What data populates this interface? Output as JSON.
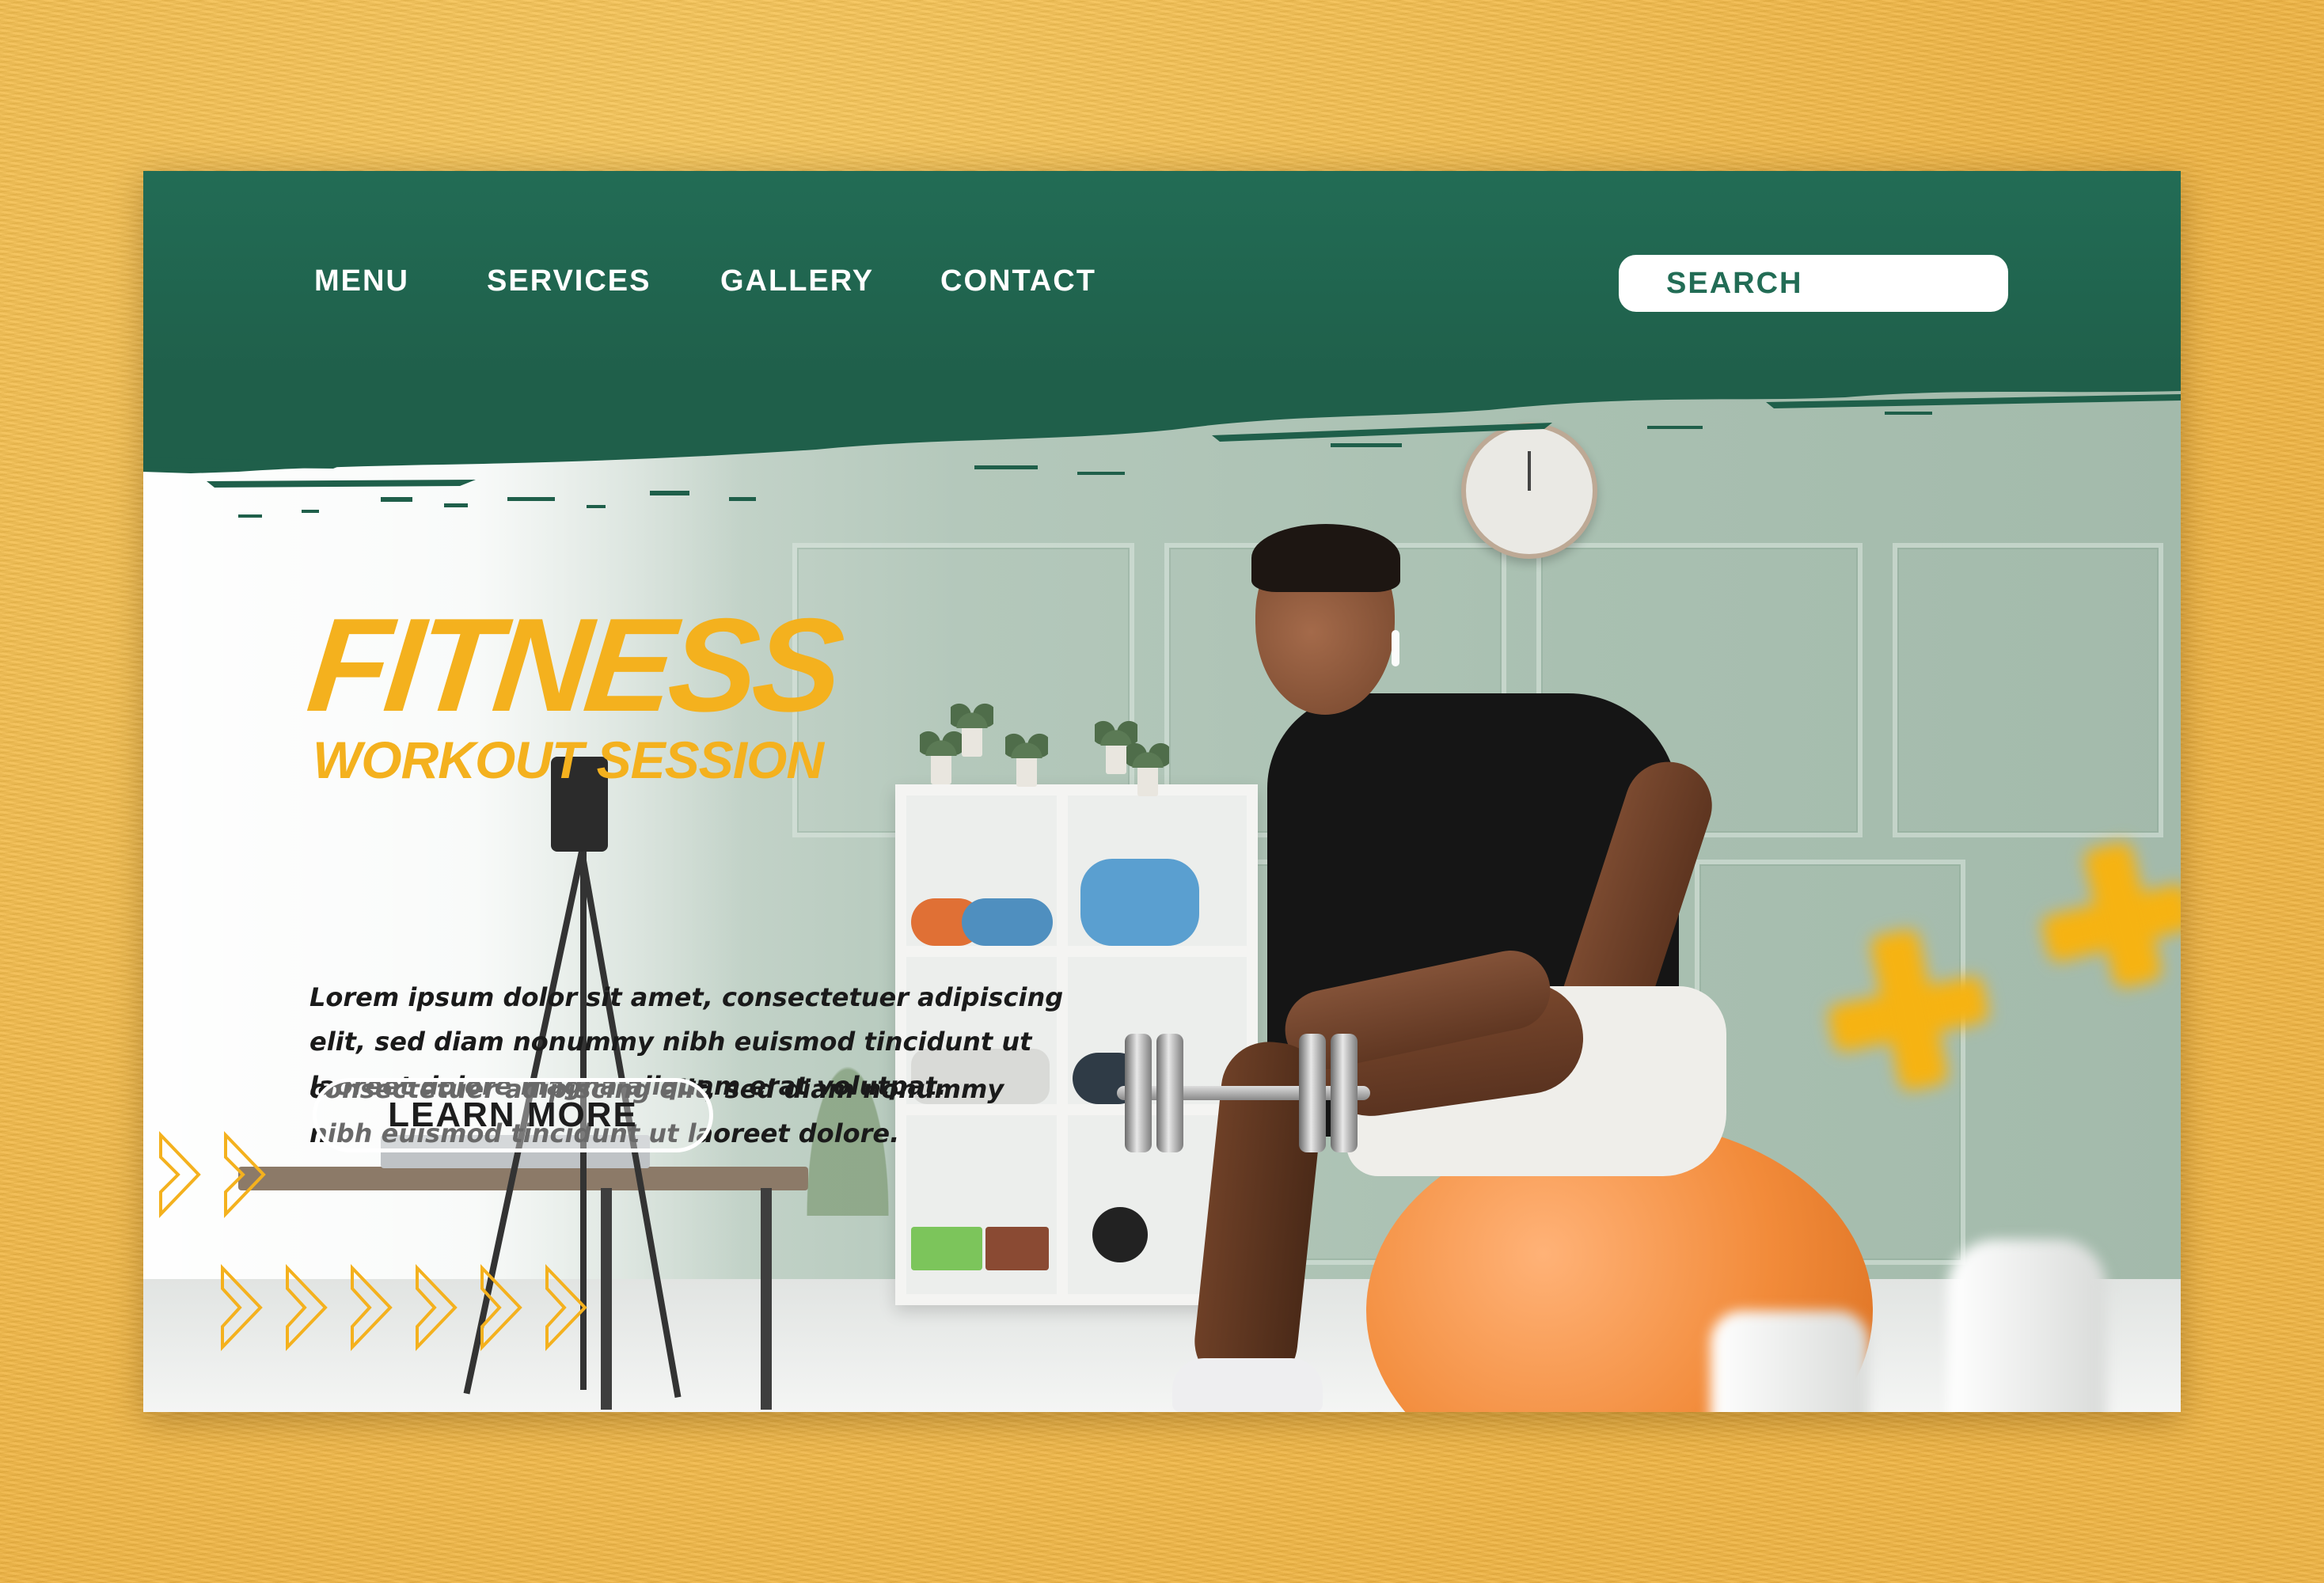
{
  "nav": {
    "items": [
      {
        "label": "MENU"
      },
      {
        "label": "SERVICES"
      },
      {
        "label": "GALLERY"
      },
      {
        "label": "CONTACT"
      }
    ],
    "search_label": "SEARCH"
  },
  "hero": {
    "title": "FITNESS",
    "subtitle": "WORKOUT SESSION",
    "paragraph_1": "Lorem ipsum dolor sit amet, consectetuer adipiscing elit, sed diam nonummy nibh euismod tincidunt ut laoreet dolore magna aliquam erat volutpat.",
    "paragraph_2": "consectetuer adipiscing elit, sed diam nonummy nibh euismod tincidunt ut laoreet dolore.",
    "cta_label": "LEARN MORE"
  },
  "colors": {
    "header_green": "#226c55",
    "accent_yellow": "#f4b11e",
    "background_yellow": "#f4bd4e",
    "text_dark": "#1a1a1a"
  },
  "icons": {
    "chevrons": "double-chevron-right-icon",
    "photo": "man-with-dumbbell-on-exercise-ball"
  }
}
